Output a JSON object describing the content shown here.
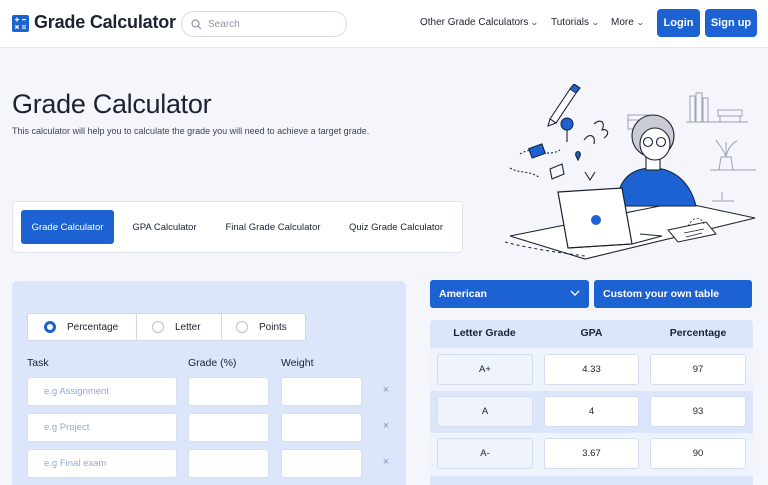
{
  "header": {
    "logo_text": "Grade Calculator",
    "search_placeholder": "Search",
    "nav": {
      "other": "Other Grade Calculators",
      "tutorials": "Tutorials",
      "more": "More"
    },
    "login": "Login",
    "signup": "Sign up"
  },
  "hero": {
    "title": "Grade Calculator",
    "description": "This calculator will help you to calculate the grade you will need to achieve a target grade."
  },
  "tabs": [
    "Grade Calculator",
    "GPA Calculator",
    "Final Grade Calculator",
    "Quiz Grade Calculator"
  ],
  "form": {
    "modes": [
      "Percentage",
      "Letter",
      "Points"
    ],
    "selected_mode": "Percentage",
    "columns": [
      "Task",
      "Grade (%)",
      "Weight"
    ],
    "rows": [
      {
        "task_placeholder": "e.g Assignment",
        "grade": "",
        "weight": "",
        "remove": "×"
      },
      {
        "task_placeholder": "e.g Project",
        "grade": "",
        "weight": "",
        "remove": "×"
      },
      {
        "task_placeholder": "e.g Final exam",
        "grade": "",
        "weight": "",
        "remove": "×"
      }
    ]
  },
  "scale": {
    "selected": "American",
    "custom_button": "Custom your own table",
    "headers": [
      "Letter Grade",
      "GPA",
      "Percentage"
    ],
    "rows": [
      [
        "A+",
        "4.33",
        "97"
      ],
      [
        "A",
        "4",
        "93"
      ],
      [
        "A-",
        "3.67",
        "90"
      ]
    ]
  },
  "colors": {
    "accent": "#1d62d2",
    "panel": "#dbe6fb",
    "background": "#f4f6fb"
  }
}
